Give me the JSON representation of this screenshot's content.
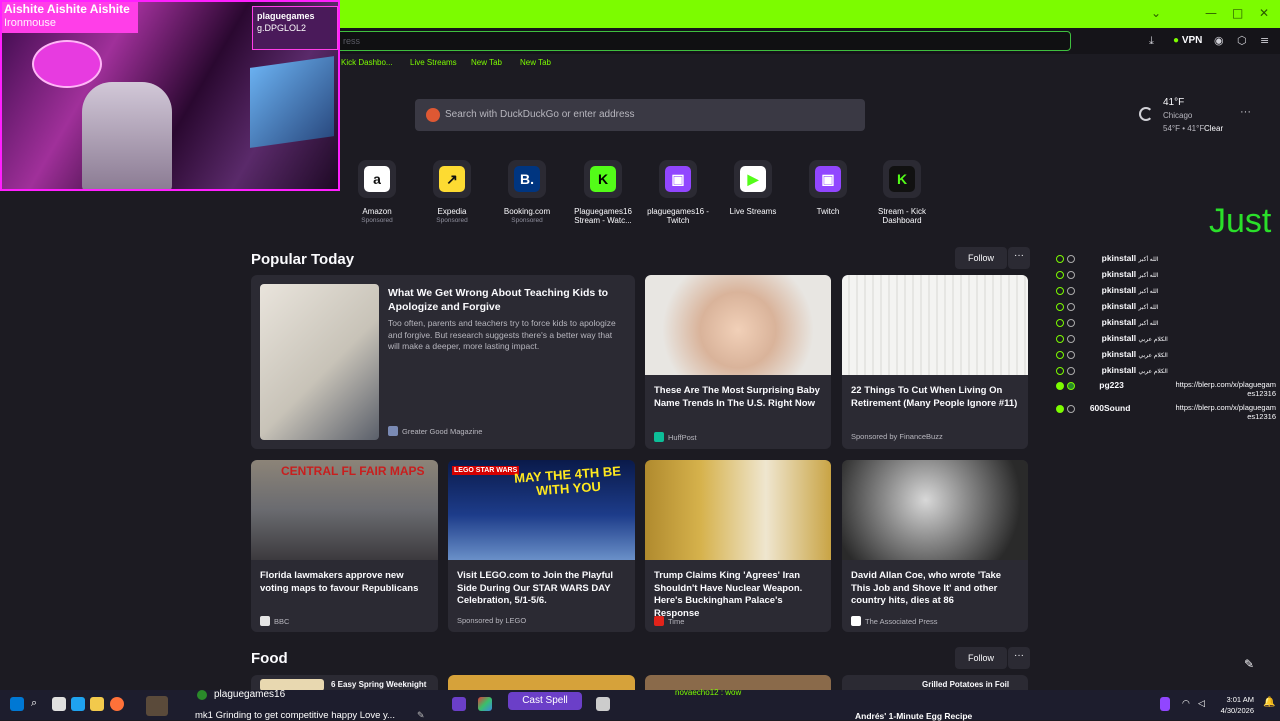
{
  "browser": {
    "url_placeholder": "ress",
    "vpn_label": "VPN",
    "bookmarks": [
      "Kick Dashbo...",
      "Live Streams",
      "New Tab",
      "New Tab"
    ],
    "accent_color": "#7cfc00"
  },
  "newtab": {
    "search_placeholder": "Search with DuckDuckGo or enter address",
    "weather": {
      "temp": "41°F",
      "city": "Chicago",
      "range": "54°F • 41°F",
      "condition": "Clear"
    },
    "shortcuts": [
      {
        "label": "Amazon",
        "sub": "Sponsored",
        "icon": "amazon-icon"
      },
      {
        "label": "Expedia",
        "sub": "Sponsored",
        "icon": "expedia-icon"
      },
      {
        "label": "Booking.com",
        "sub": "Sponsored",
        "icon": "booking-icon"
      },
      {
        "label": "Plaguegames16 Stream - Watc...",
        "sub": "",
        "icon": "kick-icon"
      },
      {
        "label": "plaguegames16 - Twitch",
        "sub": "",
        "icon": "twitch-icon"
      },
      {
        "label": "Live Streams",
        "sub": "",
        "icon": "play-icon"
      },
      {
        "label": "Twitch",
        "sub": "",
        "icon": "twitch-icon"
      },
      {
        "label": "Stream - Kick Dashboard",
        "sub": "",
        "icon": "kick-icon"
      }
    ],
    "popular": {
      "title": "Popular Today",
      "follow": "Follow",
      "more": "···",
      "featured": {
        "title": "What We Get Wrong About Teaching Kids to Apologize and Forgive",
        "excerpt": "Too often, parents and teachers try to force kids to apologize and forgive. But research suggests there's a better way that will make a deeper, more lasting impact.",
        "source": "Greater Good Magazine"
      },
      "cards": [
        {
          "title": "These Are The Most Surprising Baby Name Trends In The U.S. Right Now",
          "source": "HuffPost"
        },
        {
          "title": "22 Things To Cut When Living On Retirement (Many People Ignore #11)",
          "source": "Sponsored by FinanceBuzz"
        },
        {
          "title": "Florida lawmakers approve new voting maps to favour Republicans",
          "source": "BBC"
        },
        {
          "title": "Visit LEGO.com to Join the Playful Side During Our STAR WARS DAY Celebration, 5/1-5/6.",
          "source": "Sponsored by LEGO"
        },
        {
          "title": "Trump Claims King 'Agrees' Iran Shouldn't Have Nuclear Weapon. Here's Buckingham Palace's Response",
          "source": "Time"
        },
        {
          "title": "David Allan Coe, who wrote 'Take This Job and Shove It' and other country hits, dies at 86",
          "source": "The Associated Press"
        }
      ],
      "image_text": {
        "florida": "CENTRAL FL FAIR MAPS",
        "lego_brand": "LEGO STAR WARS",
        "lego_slogan": "MAY THE 4TH BE WITH YOU"
      }
    },
    "food": {
      "title": "Food",
      "follow": "Follow",
      "more": "···",
      "cards": [
        {
          "title": "6 Easy Spring Weeknight"
        },
        {
          "title": "Grilled Potatoes in Foil"
        },
        {
          "title": "Andrés' 1-Minute Egg Recipe"
        }
      ]
    }
  },
  "stream_overlay": {
    "cam_title": "Aishite Aishite Aishite",
    "cam_subtitle": "Ironmouse",
    "cam_tag": "plaguegames",
    "cam_tag2": "g.DPGLOL2",
    "big_text": "Just",
    "chat": [
      {
        "user": "pkinstall",
        "msg": "الله أكبر"
      },
      {
        "user": "pkinstall",
        "msg": "الله أكبر"
      },
      {
        "user": "pkinstall",
        "msg": "الله أكبر"
      },
      {
        "user": "pkinstall",
        "msg": "الله أكبر"
      },
      {
        "user": "pkinstall",
        "msg": "الله أكبر"
      },
      {
        "user": "pkinstall",
        "msg": "الكلام عربي"
      },
      {
        "user": "pkinstall",
        "msg": "الكلام عربي"
      },
      {
        "user": "pkinstall",
        "msg": "الكلام عربي"
      },
      {
        "user": "pg223",
        "msg": "https://blerp.com/x/plaguegam es12316"
      },
      {
        "user": "600Sound",
        "msg": "https://blerp.com/x/plaguegam es12316"
      }
    ],
    "now_playing_user": "plaguegames16",
    "now_playing_msg": "mk1 Grinding to get competitive happy Love y...",
    "cast_spell": "Cast Spell",
    "bottom_chat": "novaecho12 : wow"
  },
  "taskbar": {
    "time": "3:01 AM",
    "date": "4/30/2026"
  }
}
